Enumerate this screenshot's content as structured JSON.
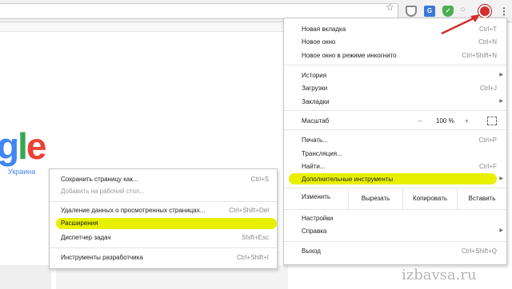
{
  "toolbar": {
    "icons": [
      "bookmark-star-icon",
      "shield-extension-icon",
      "translate-extension-icon",
      "adguard-extension-icon",
      "search-extension-icon",
      "opera-extension-icon",
      "menu-dots-icon"
    ],
    "translate_glyph": "G",
    "adguard_glyph": "✓",
    "star_glyph": "☆",
    "search_glyph": "○",
    "dots_glyph": "⋮"
  },
  "page": {
    "logo": {
      "g": "g",
      "l": "l",
      "e": "e"
    },
    "region": "Украина"
  },
  "main_menu": {
    "new_tab": {
      "label": "Новая вкладка",
      "shortcut": "Ctrl+T"
    },
    "new_window": {
      "label": "Новое окно",
      "shortcut": "Ctrl+N"
    },
    "incognito": {
      "label": "Новое окно в режиме инкогнито",
      "shortcut": "Ctrl+Shift+N"
    },
    "history": {
      "label": "История",
      "arrow": "▶"
    },
    "downloads": {
      "label": "Загрузки",
      "shortcut": "Ctrl+J"
    },
    "bookmarks": {
      "label": "Закладки",
      "arrow": "▶"
    },
    "zoom": {
      "label": "Масштаб",
      "minus": "–",
      "value": "100 %",
      "plus": "+"
    },
    "print": {
      "label": "Печать...",
      "shortcut": "Ctrl+P"
    },
    "cast": {
      "label": "Трансляция..."
    },
    "find": {
      "label": "Найти...",
      "shortcut": "Ctrl+F"
    },
    "more_tools": {
      "label": "Дополнительные инструменты",
      "arrow": "▶"
    },
    "edit": {
      "label": "Изменить",
      "cut": "Вырезать",
      "copy": "Копировать",
      "paste": "Вставить"
    },
    "settings": {
      "label": "Настройки"
    },
    "help": {
      "label": "Справка",
      "arrow": "▶"
    },
    "exit": {
      "label": "Выход",
      "shortcut": "Ctrl+Shift+Q"
    }
  },
  "sub_menu": {
    "save_page": {
      "label": "Сохранить страницу как...",
      "shortcut": "Ctrl+S"
    },
    "add_desktop": {
      "label": "Добавить на рабочий стол..."
    },
    "clear_data": {
      "label": "Удаление данных о просмотренных страницах...",
      "shortcut": "Ctrl+Shift+Del"
    },
    "extensions": {
      "label": "Расширения"
    },
    "task_manager": {
      "label": "Диспетчер задач",
      "shortcut": "Shift+Esc"
    },
    "dev_tools": {
      "label": "Инструменты разработчика",
      "shortcut": "Ctrl+Shift+I"
    }
  },
  "highlight_color": "#e8f000",
  "arrow_color": "#d32f2f",
  "watermark": "izbavsa.ru"
}
